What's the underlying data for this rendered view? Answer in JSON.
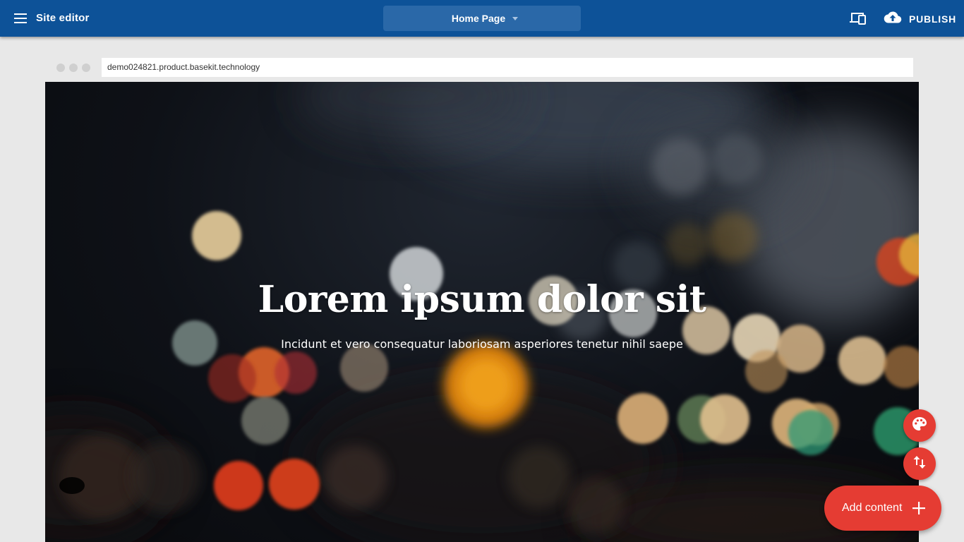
{
  "topbar": {
    "title": "Site editor",
    "page_selector": {
      "selected": "Home Page"
    },
    "publish_label": "PUBLISH",
    "icons": {
      "menu": "hamburger-menu-icon",
      "device": "device-preview-icon",
      "publish": "cloud-upload-icon",
      "caret": "caret-down-icon"
    }
  },
  "browser": {
    "url": "demo024821.product.basekit.technology"
  },
  "hero": {
    "title": "Lorem ipsum dolor sit",
    "subtitle": "Incidunt et vero consequatur laboriosam asperiores tenetur nihil saepe"
  },
  "actions": {
    "add_content_label": "Add content",
    "icons": {
      "theme": "palette-icon",
      "reorder": "swap-vertical-icon",
      "add": "plus-icon"
    }
  },
  "colors": {
    "topbar": "#0d5298",
    "page_selector": "#2a68a8",
    "fab": "#e53c33",
    "canvas": "#e8e8e8"
  }
}
